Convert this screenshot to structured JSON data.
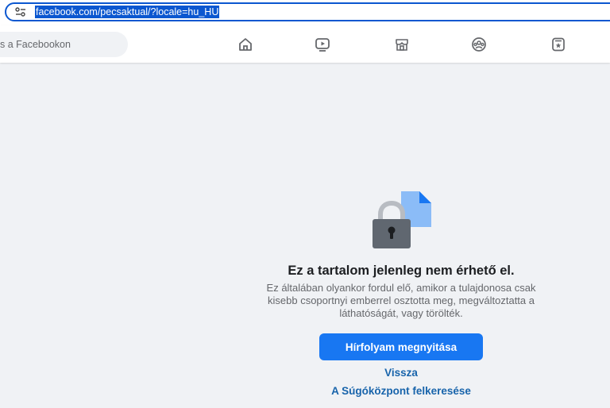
{
  "browser": {
    "url": "facebook.com/pecsaktual/?locale=hu_HU",
    "site_info_icon": "tune-icon"
  },
  "header": {
    "search_placeholder": "s a Facebookon",
    "nav_icons": [
      "home-icon",
      "video-icon",
      "marketplace-icon",
      "groups-icon",
      "gaming-icon"
    ]
  },
  "main": {
    "illustration_icon": "lock-document-icon",
    "title": "Ez a tartalom jelenleg nem érhető el.",
    "description": "Ez általában olyankor fordul elő, amikor a tulajdonosa csak kisebb csoportnyi emberrel osztotta meg, megváltoztatta a láthatóságát, vagy törölték.",
    "primary_button": "Hírfolyam megnyitása",
    "back_link": "Vissza",
    "help_link": "A Súgóközpont felkeresése"
  },
  "colors": {
    "accent": "#1877f2",
    "link": "#1864ab",
    "url_highlight": "#0b57d0",
    "background": "#f0f2f5"
  }
}
